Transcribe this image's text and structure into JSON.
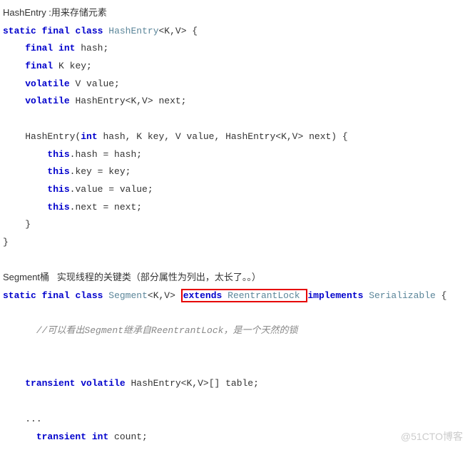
{
  "intro1_prefix": "HashEntry :",
  "intro1_text": "用来存储元素",
  "line1": {
    "static": "static",
    "final": "final",
    "class": "class",
    "name": "HashEntry",
    "generic": "<K,V> {"
  },
  "line2": {
    "final": "final",
    "int": "int",
    "hash": " hash;"
  },
  "line3": {
    "final": "final",
    "k": " K key;"
  },
  "line4": {
    "volatile": "volatile",
    "v": " V value;"
  },
  "line5": {
    "volatile": "volatile",
    "rest": " HashEntry<K,V> next;"
  },
  "line6": {
    "ctor_pre": "HashEntry(",
    "int": "int",
    "args": " hash, K key, V value, HashEntry<K,V> next) {"
  },
  "line7": {
    "this": "this",
    "rest": ".hash = hash;"
  },
  "line8": {
    "this": "this",
    "rest": ".key = key;"
  },
  "line9": {
    "this": "this",
    "rest": ".value = value;"
  },
  "line10": {
    "this": "this",
    "rest": ".next = next;"
  },
  "close1": "}",
  "close2": "}",
  "intro2": "Segment桶   实现线程的关键类（部分属性为列出，太长了。。）",
  "seg": {
    "static": "static",
    "final": "final",
    "class": "class",
    "name": "Segment",
    "generic": "<K,V>",
    "extends": "extends",
    "parent": "ReentrantLock",
    "implements": "implements",
    "iface": "Serializable",
    "open": " {"
  },
  "comment": "//可以看出Segment继承自ReentrantLock，是一个天然的锁",
  "field1": {
    "transient": "transient",
    "volatile": "volatile",
    "rest": " HashEntry<K,V>[] table;"
  },
  "dots": "...",
  "field2": {
    "transient": "transient",
    "int": "int",
    "rest": " count;"
  },
  "watermark": "@51CTO博客"
}
